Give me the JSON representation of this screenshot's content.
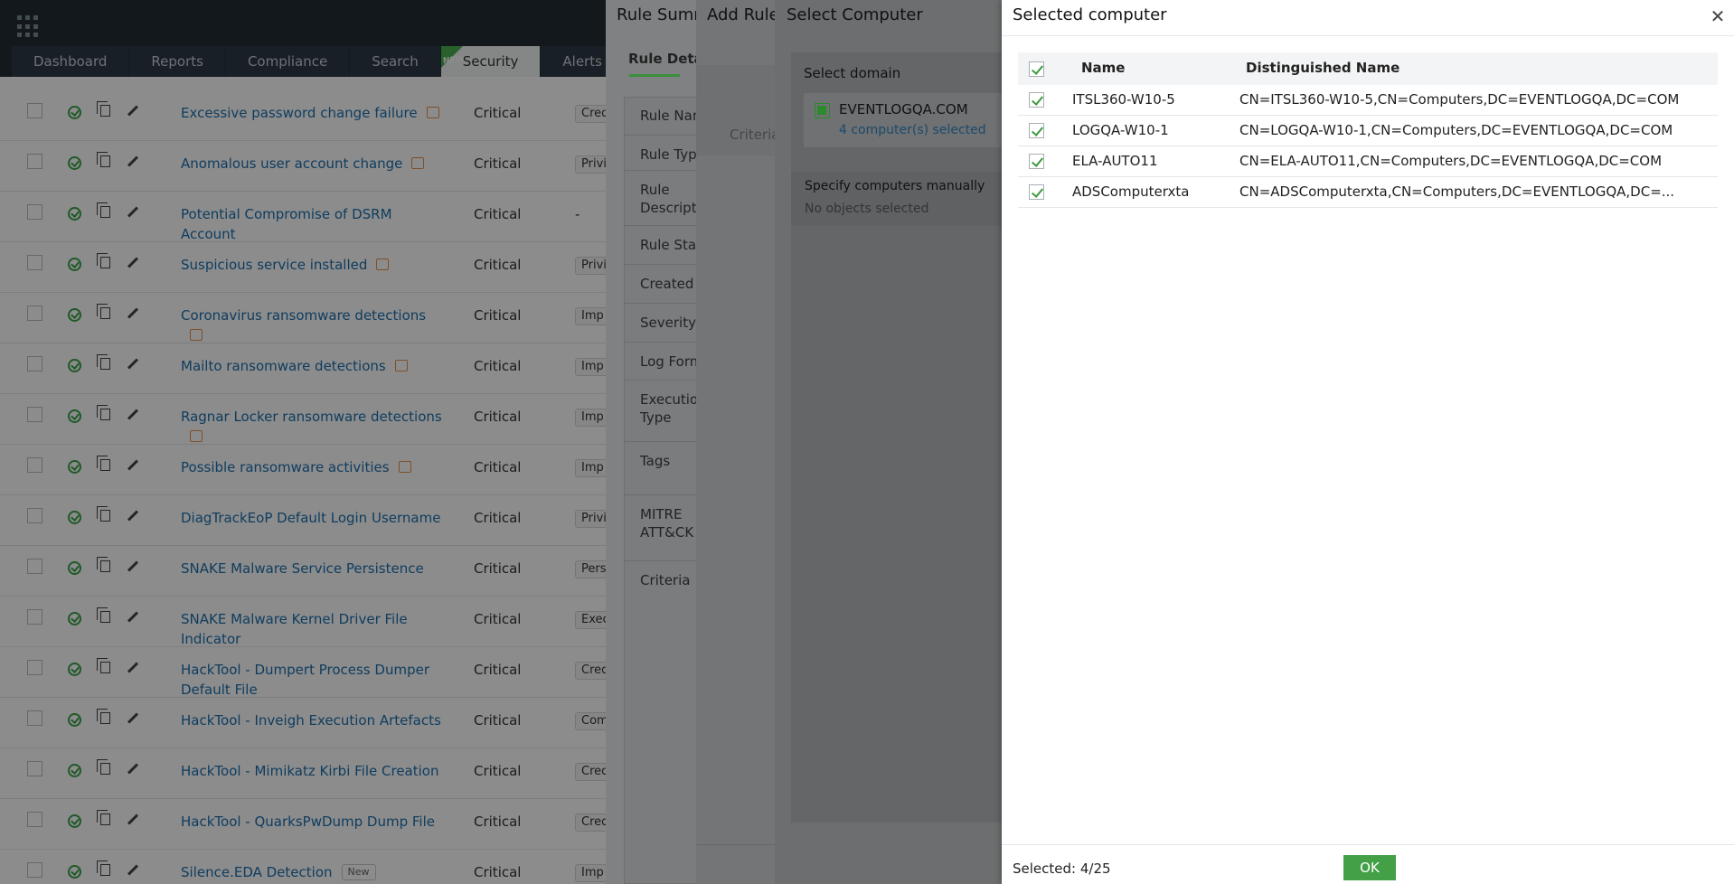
{
  "nav": {
    "tabs": [
      "Dashboard",
      "Reports",
      "Compliance",
      "Search",
      "Security",
      "Alerts"
    ],
    "new_flag": "NEW"
  },
  "rules": [
    {
      "name": "Excessive password change failure",
      "severity": "Critical",
      "category": "Cred",
      "tag": true
    },
    {
      "name": "Anomalous user account change",
      "severity": "Critical",
      "category": "Privi",
      "tag": true
    },
    {
      "name": "Potential Compromise of DSRM Account",
      "severity": "Critical",
      "category": "-",
      "tag": false
    },
    {
      "name": "Suspicious service installed",
      "severity": "Critical",
      "category": "Privi",
      "tag": true
    },
    {
      "name": "Coronavirus ransomware detections",
      "severity": "Critical",
      "category": "Imp",
      "tag": true
    },
    {
      "name": "Mailto ransomware detections",
      "severity": "Critical",
      "category": "Imp",
      "tag": true
    },
    {
      "name": "Ragnar Locker ransomware detections",
      "severity": "Critical",
      "category": "Imp",
      "tag": true
    },
    {
      "name": "Possible ransomware activities",
      "severity": "Critical",
      "category": "Imp",
      "tag": true
    },
    {
      "name": "DiagTrackEoP Default Login Username",
      "severity": "Critical",
      "category": "Privi",
      "tag": false
    },
    {
      "name": "SNAKE Malware Service Persistence",
      "severity": "Critical",
      "category": "Pers",
      "tag": false
    },
    {
      "name": "SNAKE Malware Kernel Driver File Indicator",
      "severity": "Critical",
      "category": "Exec",
      "tag": false
    },
    {
      "name": "HackTool - Dumpert Process Dumper Default File",
      "severity": "Critical",
      "category": "Cred",
      "tag": false
    },
    {
      "name": "HackTool - Inveigh Execution Artefacts",
      "severity": "Critical",
      "category": "Com",
      "tag": false
    },
    {
      "name": "HackTool - Mimikatz Kirbi File Creation",
      "severity": "Critical",
      "category": "Cred",
      "tag": false
    },
    {
      "name": "HackTool - QuarksPwDump Dump File",
      "severity": "Critical",
      "category": "Cred",
      "tag": false
    },
    {
      "name": "Silence.EDA Detection",
      "severity": "Critical",
      "category": "Imp",
      "tag": false,
      "badge": "New"
    }
  ],
  "rule_summary": {
    "title": "Rule Summ",
    "tab": "Rule Deta",
    "fields": [
      "Rule Nan",
      "Rule Type",
      "Rule Descripti",
      "Rule Stat",
      "Created I",
      "Severity",
      "Log Form",
      "Execution Type",
      "Tags",
      "MITRE ATT&CK",
      "Criteria"
    ]
  },
  "add_rule": {
    "title": "Add Rule",
    "criteria": "Criteria"
  },
  "select_computer": {
    "title": "Select Computer",
    "select_domain_label": "Select domain",
    "domain_name": "EVENTLOGQA.COM",
    "domain_count": "4 computer(s) selected",
    "manual_title": "Specify computers manually",
    "manual_sub": "No objects selected"
  },
  "selected_computer": {
    "title": "Selected computer",
    "columns": {
      "name": "Name",
      "dn": "Distinguished Name"
    },
    "rows": [
      {
        "name": "ITSL360-W10-5",
        "dn": "CN=ITSL360-W10-5,CN=Computers,DC=EVENTLOGQA,DC=COM"
      },
      {
        "name": "LOGQA-W10-1",
        "dn": "CN=LOGQA-W10-1,CN=Computers,DC=EVENTLOGQA,DC=COM"
      },
      {
        "name": "ELA-AUTO11",
        "dn": "CN=ELA-AUTO11,CN=Computers,DC=EVENTLOGQA,DC=COM"
      },
      {
        "name": "ADSComputerxta",
        "dn": "CN=ADSComputerxta,CN=Computers,DC=EVENTLOGQA,DC=..."
      }
    ],
    "footer_selected": "Selected: 4/25",
    "ok_label": "OK"
  }
}
